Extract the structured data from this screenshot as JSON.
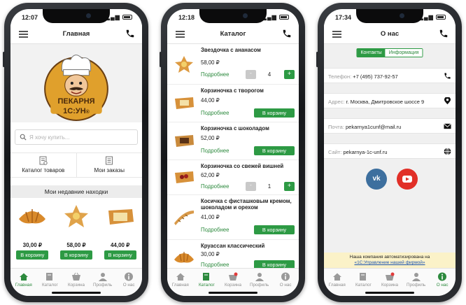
{
  "screens": [
    {
      "status": {
        "time": "12:07"
      },
      "header": {
        "title": "Главная"
      },
      "logo": {
        "line1": "ПЕКАРНЯ",
        "line2": "1С:УН"
      },
      "search": {
        "placeholder": "Я хочу купить..."
      },
      "menu": [
        {
          "label": "Каталог товаров"
        },
        {
          "label": "Мои заказы"
        }
      ],
      "recent_title": "Мои недавние находки",
      "recent": [
        {
          "price": "30,00 ₽",
          "button": "В корзину"
        },
        {
          "price": "58,00 ₽",
          "button": "В корзину"
        },
        {
          "price": "44,00 ₽",
          "button": "В корзину"
        }
      ]
    },
    {
      "status": {
        "time": "12:18"
      },
      "header": {
        "title": "Каталог"
      },
      "items": [
        {
          "name": "Звездочка с ананасом",
          "price": "58,00 ₽",
          "more": "Подробнее",
          "qty": "4",
          "minus": "-",
          "plus": "+"
        },
        {
          "name": "Корзиночка с творогом",
          "price": "44,00 ₽",
          "more": "Подробнее",
          "button": "В корзину"
        },
        {
          "name": "Корзиночка с шоколадом",
          "price": "52,00 ₽",
          "more": "Подробнее",
          "button": "В корзину"
        },
        {
          "name": "Корзиночка со свежей вишней",
          "price": "62,00 ₽",
          "more": "Подробнее",
          "qty": "1",
          "minus": "-",
          "plus": "+"
        },
        {
          "name": "Косичка с фисташковым кремом, шоколадом и орехом",
          "price": "41,00 ₽",
          "more": "Подробнее",
          "button": "В корзину"
        },
        {
          "name": "Круассан классический",
          "price": "30,00 ₽",
          "more": "Подробнее",
          "button": "В корзину"
        }
      ]
    },
    {
      "status": {
        "time": "17:34"
      },
      "header": {
        "title": "О нас"
      },
      "segments": {
        "contacts": "Контакты",
        "info": "Информация"
      },
      "rows": {
        "phone": {
          "label": "Телефон:",
          "value": "+7 (495) 737-92-57"
        },
        "address": {
          "label": "Адрес:",
          "value": "г. Москва, Дмитровское шоссе 9"
        },
        "mail": {
          "label": "Почта:",
          "value": "pekarnya1cunf@mail.ru"
        },
        "site": {
          "label": "Сайт:",
          "value": "pekarnya-1c-unf.ru"
        }
      },
      "social": {
        "vk": "vk"
      },
      "footer": {
        "line1": "Наша компания автоматизирована на",
        "link": "«1С:Управление нашей фирмой»"
      }
    }
  ],
  "tabs": [
    {
      "label": "Главная",
      "icon": "home-icon"
    },
    {
      "label": "Каталог",
      "icon": "catalog-icon"
    },
    {
      "label": "Корзина",
      "icon": "cart-icon"
    },
    {
      "label": "Профиль",
      "icon": "profile-icon"
    },
    {
      "label": "О нас",
      "icon": "info-icon"
    }
  ],
  "colors": {
    "accent": "#2d9a44",
    "vk": "#3d6f9e",
    "youtube": "#e12f27",
    "footer_bg": "#fbf2c8"
  }
}
